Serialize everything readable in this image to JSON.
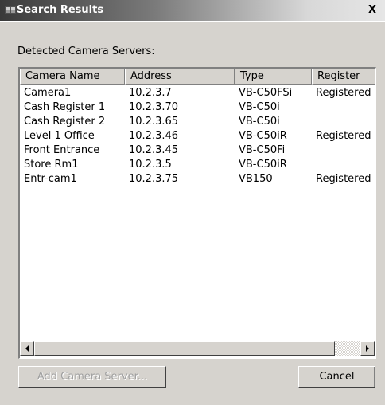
{
  "window": {
    "title": "Search Results",
    "close_symbol": "X"
  },
  "section_label": "Detected Camera Servers:",
  "table": {
    "columns": [
      "Camera Name",
      "Address",
      "Type",
      "Register"
    ],
    "rows": [
      [
        "Camera1",
        "10.2.3.7",
        "VB-C50FSi",
        "Registered"
      ],
      [
        "Cash Register 1",
        "10.2.3.70",
        "VB-C50i",
        ""
      ],
      [
        "Cash Register 2",
        "10.2.3.65",
        "VB-C50i",
        ""
      ],
      [
        "Level 1 Office",
        "10.2.3.46",
        "VB-C50iR",
        "Registered"
      ],
      [
        "Front Entrance",
        "10.2.3.45",
        "VB-C50Fi",
        ""
      ],
      [
        "Store Rm1",
        "10.2.3.5",
        "VB-C50iR",
        ""
      ],
      [
        "Entr-cam1",
        "10.2.3.75",
        "VB150",
        "Registered"
      ]
    ]
  },
  "buttons": {
    "add_camera": "Add Camera Server...",
    "add_camera_enabled": false,
    "cancel": "Cancel"
  },
  "icons": {
    "window_icon": "app-window-icon",
    "scroll_left": "scroll-left-arrow-icon",
    "scroll_right": "scroll-right-arrow-icon"
  }
}
